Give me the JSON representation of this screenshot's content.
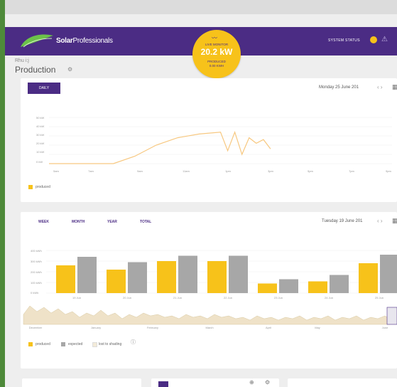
{
  "header": {
    "brand_bold": "Solar",
    "brand_rest": "Professionals",
    "system_status": "SYSTEM STATUS"
  },
  "monitor": {
    "label": "LIVE MONITOR",
    "value": "20.2 kW",
    "sub1": "PRODUCED",
    "sub2": "0.00 KWH"
  },
  "page": {
    "breadcrumb": "Rhu i:j",
    "title": "Production"
  },
  "daily_panel": {
    "button": "DAILY",
    "date": "Monday 25 June 201",
    "y_ticks": [
      "50 kW",
      "40 kW",
      "30 kW",
      "20 kW",
      "10 kW",
      "0 kW"
    ],
    "x_ticks": [
      "5am",
      "7am",
      "9am",
      "11am",
      "1pm",
      "3pm",
      "5pm",
      "7pm",
      "9pm"
    ],
    "legend": "produced"
  },
  "period_panel": {
    "tabs": [
      "WEEK",
      "MONTH",
      "YEAR",
      "TOTAL"
    ],
    "date": "Tuesday 19 June 201",
    "y_ticks": [
      "400 kWh",
      "300 kWh",
      "200 kWh",
      "100 kWh",
      "0 kWh"
    ],
    "x_ticks": [
      "19 Jun",
      "20 Jun",
      "21 Jun",
      "22 Jun",
      "23 Jun",
      "24 Jun",
      "25 Jun"
    ],
    "overview_months": [
      "December",
      "January",
      "February",
      "March",
      "April",
      "May",
      "June"
    ],
    "legend": [
      "produced",
      "expected",
      "lost to shading"
    ]
  },
  "colors": {
    "purple": "#4b2c84",
    "yellow": "#f7c21a",
    "gray": "#a7a7a7",
    "green_border": "#4e8a3a"
  },
  "chart_data": [
    {
      "type": "line",
      "series": [
        {
          "name": "produced",
          "x": [
            "5am",
            "6am",
            "7am",
            "8am",
            "9am",
            "10am",
            "11am",
            "12pm",
            "1pm",
            "1:20pm",
            "1:40pm",
            "2pm",
            "2:20pm",
            "2:40pm",
            "3pm",
            "3:20pm"
          ],
          "values": [
            0,
            0,
            0,
            0,
            8,
            20,
            28,
            32,
            34,
            14,
            34,
            10,
            28,
            22,
            26,
            16
          ]
        }
      ],
      "ylim": [
        0,
        50
      ]
    },
    {
      "type": "bar",
      "categories": [
        "19 Jun",
        "20 Jun",
        "21 Jun",
        "22 Jun",
        "23 Jun",
        "24 Jun",
        "25 Jun"
      ],
      "series": [
        {
          "name": "produced",
          "values": [
            260,
            220,
            300,
            300,
            90,
            110,
            280
          ]
        },
        {
          "name": "expected",
          "values": [
            340,
            290,
            350,
            350,
            130,
            170,
            360
          ]
        }
      ],
      "ylim": [
        0,
        400
      ]
    }
  ]
}
